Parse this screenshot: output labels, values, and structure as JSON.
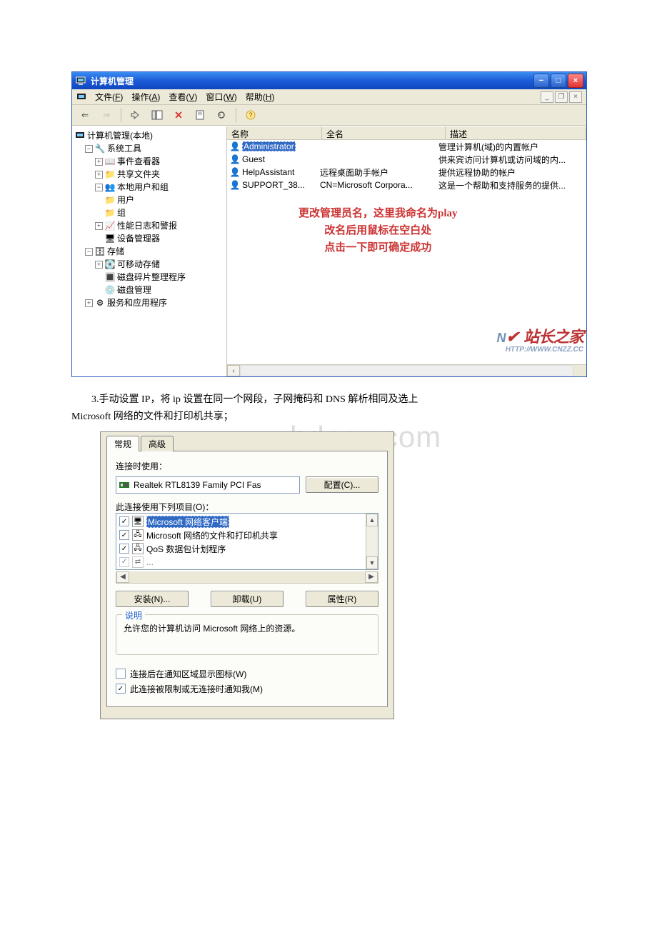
{
  "page_watermark": "www.bdocx.com",
  "win1": {
    "title": "计算机管理",
    "menu": {
      "file": {
        "label": "文件",
        "hotkey": "F"
      },
      "action": {
        "label": "操作",
        "hotkey": "A"
      },
      "view": {
        "label": "查看",
        "hotkey": "V"
      },
      "window": {
        "label": "窗口",
        "hotkey": "W"
      },
      "help": {
        "label": "帮助",
        "hotkey": "H"
      }
    },
    "tree": {
      "root": "计算机管理(本地)",
      "systools": "系统工具",
      "eventviewer": "事件查看器",
      "shared": "共享文件夹",
      "localusers": "本地用户和组",
      "users": "用户",
      "groups": "组",
      "perf": "性能日志和警报",
      "devmgr": "设备管理器",
      "storage": "存储",
      "removable": "可移动存储",
      "defrag": "磁盘碎片整理程序",
      "diskmgr": "磁盘管理",
      "services": "服务和应用程序"
    },
    "columns": {
      "name": "名称",
      "fullname": "全名",
      "desc": "描述"
    },
    "rows": [
      {
        "name": "Administrator",
        "fullname": "",
        "desc": "管理计算机(域)的内置帐户"
      },
      {
        "name": "Guest",
        "fullname": "",
        "desc": "供来宾访问计算机或访问域的内..."
      },
      {
        "name": "HelpAssistant",
        "fullname": "远程桌面助手帐户",
        "desc": "提供远程协助的帐户"
      },
      {
        "name": "SUPPORT_38...",
        "fullname": "CN=Microsoft Corpora...",
        "desc": "这是一个帮助和支持服务的提供..."
      }
    ],
    "annotation": {
      "l1": "更改管理员名，这里我命名为play",
      "l2": "改名后用鼠标在空白处",
      "l3": "点击一下即可确定成功"
    },
    "logo": {
      "brand": "站长之家",
      "url": "HTTP://WWW.CNZZ.CC"
    }
  },
  "body_text": {
    "p1": "3.手动设置 IP，将 ip 设置在同一个网段，子网掩码和 DNS 解析相同及选上",
    "p2": "Microsoft 网络的文件和打印机共享；"
  },
  "dlg": {
    "tabs": {
      "general": "常规",
      "advanced": "高级"
    },
    "connect_using": "连接时使用：",
    "adapter": "Realtek RTL8139 Family PCI Fas",
    "configure": "配置(C)...",
    "items_label": "此连接使用下列项目(O)：",
    "items": [
      {
        "checked": true,
        "label": "Microsoft 网络客户端",
        "selected": true
      },
      {
        "checked": true,
        "label": "Microsoft 网络的文件和打印机共享",
        "selected": false
      },
      {
        "checked": true,
        "label": "QoS 数据包计划程序",
        "selected": false
      }
    ],
    "install": "安装(N)...",
    "uninstall": "卸载(U)",
    "properties": "属性(R)",
    "group_legend": "说明",
    "group_text": "允许您的计算机访问 Microsoft 网络上的资源。",
    "chk1": {
      "checked": false,
      "label": "连接后在通知区域显示图标(W)"
    },
    "chk2": {
      "checked": true,
      "label": "此连接被限制或无连接时通知我(M)"
    }
  }
}
